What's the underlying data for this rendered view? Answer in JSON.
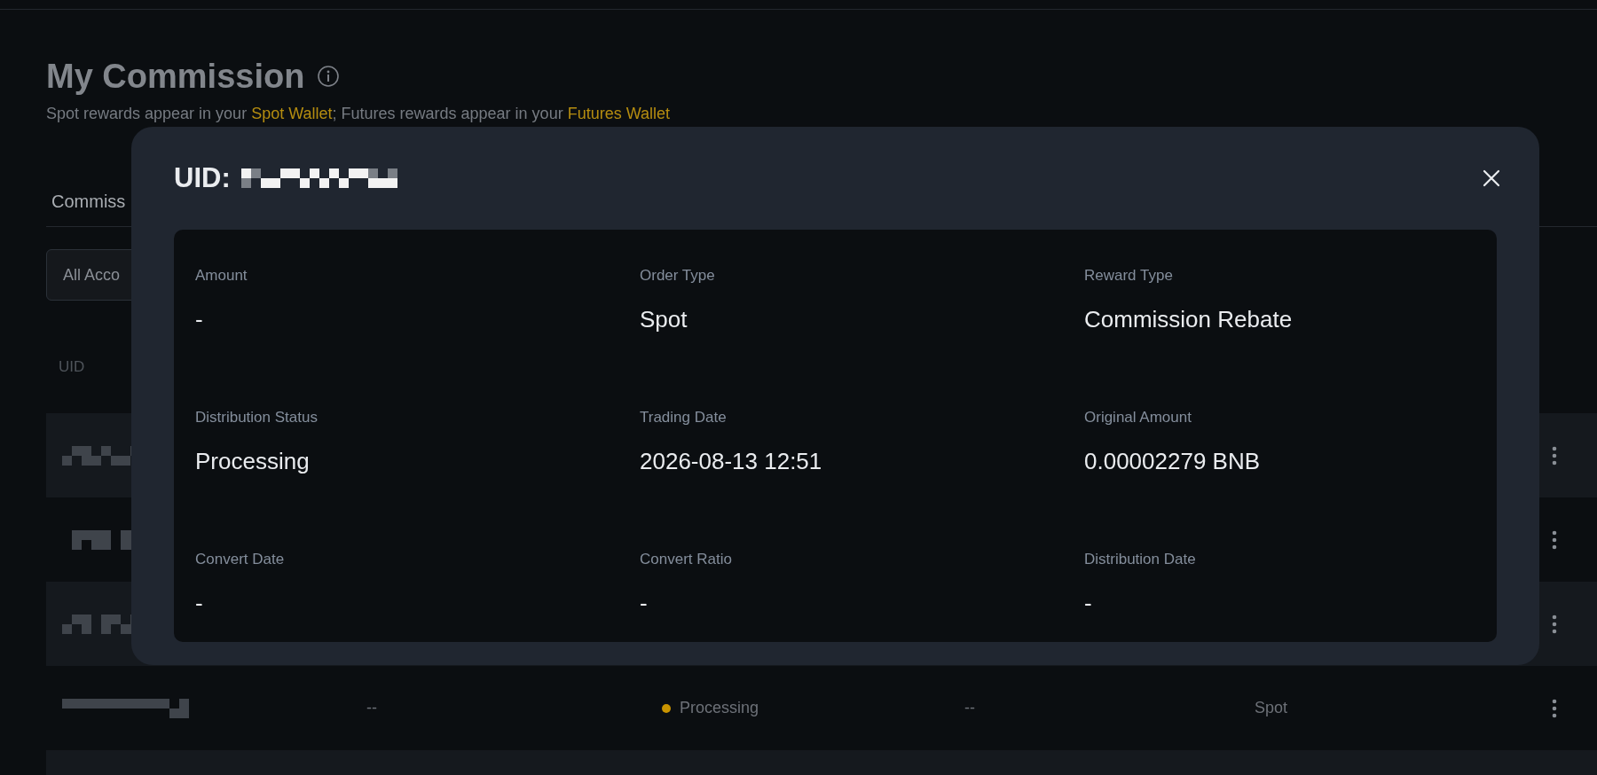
{
  "page": {
    "title": "My Commission",
    "subtitle": [
      {
        "text": "Spot rewards appear in your ",
        "link": false
      },
      {
        "text": "Spot Wallet",
        "link": true
      },
      {
        "text": "; Futures rewards appear in your ",
        "link": false
      },
      {
        "text": "Futures Wallet",
        "link": true
      }
    ],
    "tabs": [
      {
        "label": "Commiss"
      }
    ],
    "filter": {
      "value": "All Acco"
    },
    "table": {
      "columns": [
        "UID"
      ],
      "rows": [
        {
          "highlighted": true,
          "cells": []
        },
        {
          "highlighted": false,
          "cells": []
        },
        {
          "highlighted": true,
          "cells": []
        },
        {
          "highlighted": false,
          "cells": [
            "--",
            "--",
            "Spot"
          ],
          "status": {
            "text": "Processing",
            "color": "#c99400"
          }
        },
        {
          "highlighted": true,
          "cells": []
        }
      ]
    }
  },
  "modal": {
    "title": "UID:",
    "fields": [
      {
        "label": "Amount",
        "value": "-"
      },
      {
        "label": "Order Type",
        "value": "Spot"
      },
      {
        "label": "Reward Type",
        "value": "Commission Rebate"
      },
      {
        "label": "Distribution Status",
        "value": "Processing"
      },
      {
        "label": "Trading Date",
        "value": "2026-08-13 12:51"
      },
      {
        "label": "Original Amount",
        "value": "0.00002279 BNB"
      },
      {
        "label": "Convert Date",
        "value": "-"
      },
      {
        "label": "Convert Ratio",
        "value": "-"
      },
      {
        "label": "Distribution Date",
        "value": "-"
      }
    ]
  }
}
